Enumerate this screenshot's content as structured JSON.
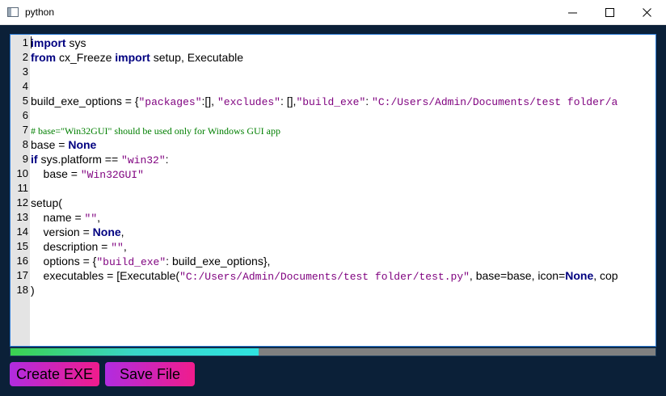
{
  "window": {
    "title": "python",
    "minimize_icon": "minimize-icon",
    "maximize_icon": "maximize-icon",
    "close_icon": "close-icon"
  },
  "editor": {
    "lines": [
      {
        "num": "1",
        "tokens": [
          {
            "t": "import",
            "c": "kw"
          },
          {
            "t": " sys",
            "c": ""
          }
        ]
      },
      {
        "num": "2",
        "tokens": [
          {
            "t": "from",
            "c": "kw"
          },
          {
            "t": " cx_Freeze ",
            "c": ""
          },
          {
            "t": "import",
            "c": "kw"
          },
          {
            "t": " setup, Executable",
            "c": ""
          }
        ]
      },
      {
        "num": "3",
        "tokens": []
      },
      {
        "num": "4",
        "tokens": []
      },
      {
        "num": "5",
        "tokens": [
          {
            "t": "build_exe_options = {",
            "c": ""
          },
          {
            "t": "\"packages\"",
            "c": "str"
          },
          {
            "t": ":[], ",
            "c": ""
          },
          {
            "t": "\"excludes\"",
            "c": "str"
          },
          {
            "t": ": [],",
            "c": ""
          },
          {
            "t": "\"build_exe\"",
            "c": "str"
          },
          {
            "t": ": ",
            "c": ""
          },
          {
            "t": "\"C:/Users/Admin/Documents/test folder/a",
            "c": "str"
          }
        ]
      },
      {
        "num": "6",
        "tokens": []
      },
      {
        "num": "7",
        "tokens": [
          {
            "t": "# base=\"Win32GUI\" should be used only for Windows GUI app",
            "c": "cmt"
          }
        ]
      },
      {
        "num": "8",
        "tokens": [
          {
            "t": "base = ",
            "c": ""
          },
          {
            "t": "None",
            "c": "kw"
          }
        ]
      },
      {
        "num": "9",
        "tokens": [
          {
            "t": "if",
            "c": "kw"
          },
          {
            "t": " sys.platform == ",
            "c": ""
          },
          {
            "t": "\"win32\"",
            "c": "str"
          },
          {
            "t": ":",
            "c": ""
          }
        ]
      },
      {
        "num": "10",
        "tokens": [
          {
            "t": "    base = ",
            "c": ""
          },
          {
            "t": "\"Win32GUI\"",
            "c": "str"
          }
        ]
      },
      {
        "num": "11",
        "tokens": []
      },
      {
        "num": "12",
        "tokens": [
          {
            "t": "setup(",
            "c": ""
          }
        ]
      },
      {
        "num": "13",
        "tokens": [
          {
            "t": "    name = ",
            "c": ""
          },
          {
            "t": "\"\"",
            "c": "str"
          },
          {
            "t": ",",
            "c": ""
          }
        ]
      },
      {
        "num": "14",
        "tokens": [
          {
            "t": "    version = ",
            "c": ""
          },
          {
            "t": "None",
            "c": "kw"
          },
          {
            "t": ",",
            "c": ""
          }
        ]
      },
      {
        "num": "15",
        "tokens": [
          {
            "t": "    description = ",
            "c": ""
          },
          {
            "t": "\"\"",
            "c": "str"
          },
          {
            "t": ",",
            "c": ""
          }
        ]
      },
      {
        "num": "16",
        "tokens": [
          {
            "t": "    options = {",
            "c": ""
          },
          {
            "t": "\"build_exe\"",
            "c": "str"
          },
          {
            "t": ": build_exe_options},",
            "c": ""
          }
        ]
      },
      {
        "num": "17",
        "tokens": [
          {
            "t": "    executables = [Executable(",
            "c": ""
          },
          {
            "t": "\"C:/Users/Admin/Documents/test folder/test.py\"",
            "c": "str"
          },
          {
            "t": ", base=base, icon=",
            "c": ""
          },
          {
            "t": "None",
            "c": "kw"
          },
          {
            "t": ", cop",
            "c": ""
          }
        ]
      },
      {
        "num": "18",
        "tokens": [
          {
            "t": ")",
            "c": ""
          }
        ]
      }
    ]
  },
  "progress": {
    "fraction": 0.385
  },
  "buttons": {
    "create_exe": "Create EXE",
    "save_file": "Save File"
  },
  "colors": {
    "window_bg": "#0b2038",
    "keyword": "#000080",
    "string": "#7f007f",
    "comment": "#007f00",
    "button_gradient_start": "#b12ce0",
    "button_gradient_end": "#f01c8c"
  }
}
